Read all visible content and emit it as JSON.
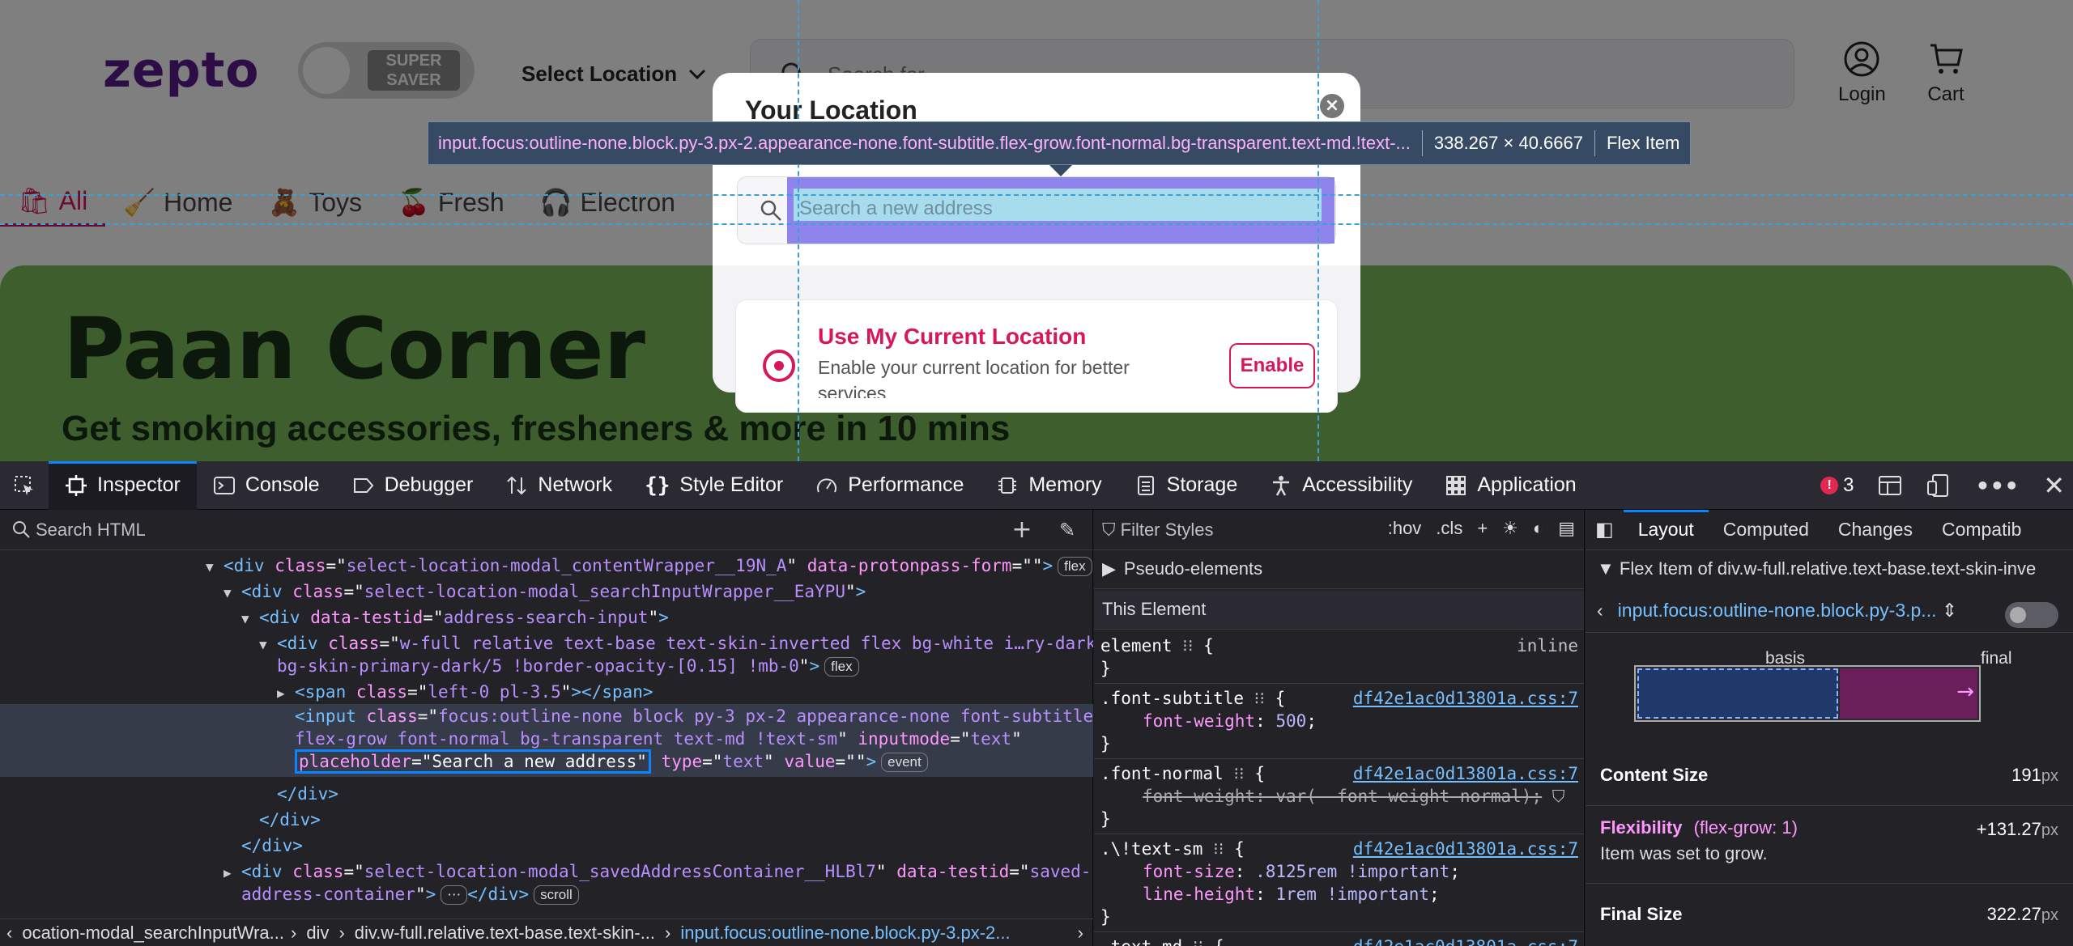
{
  "site": {
    "logo": "zepto",
    "super_saver": "SUPER SAVER",
    "select_location": "Select Location",
    "search_placeholder": "Search for",
    "login": "Login",
    "cart": "Cart",
    "categories": [
      "All",
      "Home",
      "Toys",
      "Fresh",
      "Electron"
    ],
    "banner_title": "Paan Corner",
    "banner_subtitle": "Get smoking accessories, fresheners & more in 10 mins",
    "accent_color": "#d6175c",
    "brand_color": "#5a1a8c"
  },
  "modal": {
    "title": "Your Location",
    "address_placeholder": "Search a new address",
    "current_location_title": "Use My Current Location",
    "current_location_desc": "Enable your current location for better services",
    "enable_label": "Enable"
  },
  "highlighter": {
    "selector": "input.focus:outline-none.block.py-3.px-2.appearance-none.font-subtitle.flex-grow.font-normal.bg-transparent.text-md.!text-...",
    "size": "338.267 × 40.6667",
    "kind": "Flex Item"
  },
  "devtools": {
    "tabs": [
      "Inspector",
      "Console",
      "Debugger",
      "Network",
      "Style Editor",
      "Performance",
      "Memory",
      "Storage",
      "Accessibility",
      "Application"
    ],
    "active_tab": "Inspector",
    "error_count": "3",
    "html_search_placeholder": "Search HTML",
    "tree": {
      "r1": {
        "tag": "div",
        "attr1": "class",
        "val1": "select-location-modal_contentWrapper__19N_A",
        "attr2": "data-protonpass-form",
        "val2": "",
        "badge": "flex"
      },
      "r2": {
        "tag": "div",
        "attr1": "class",
        "val1": "select-location-modal_searchInputWrapper__EaYPU"
      },
      "r3": {
        "tag": "div",
        "attr1": "data-testid",
        "val1": "address-search-input"
      },
      "r4a": "w-full relative text-base text-skin-inverted flex bg-white i…ry-dark !",
      "r4b": "bg-skin-primary-dark/5 !border-opacity-[0.15] !mb-0",
      "r4_badge": "flex",
      "r5": {
        "tag": "span",
        "attr1": "class",
        "val1": "left-0 pl-3.5"
      },
      "r6a": "focus:outline-none block py-3 px-2 appearance-none font-subtitle",
      "r6b": "flex-grow font-normal bg-transparent text-md !text-sm",
      "r6_inputmode": "text",
      "r6_placeholder": "Search a new address",
      "r6_type": "text",
      "r6_value": "",
      "r6_badge": "event",
      "r10a": "select-location-modal_savedAddressContainer__HLBl7",
      "r10_testid_a": "saved-",
      "r10_testid_b": "address-container",
      "r10_badge": "scroll"
    },
    "breadcrumbs": [
      "ocation-modal_searchInputWra...",
      "div",
      "div.w-full.relative.text-base.text-skin-...",
      "input.focus:outline-none.block.py-3.px-2..."
    ],
    "rules": {
      "filter_placeholder": "Filter Styles",
      "pseudo": "Pseudo-elements",
      "this_element": "This Element",
      "element_mode": "inline",
      "src": "df42e1ac0d13801a.css:7",
      "r1_sel": ".font-subtitle",
      "r1_prop": "font-weight",
      "r1_val": "500",
      "r2_sel": ".font-normal",
      "r2_decl": "font-weight: var(--font-weight-normal);",
      "r3_sel": ".\\!text-sm",
      "r3_p1": "font-size",
      "r3_v1": ".8125rem !important",
      "r3_p2": "line-height",
      "r3_v2": "1rem !important",
      "r4_sel": ".text-md"
    },
    "layout": {
      "tabs": [
        "Layout",
        "Computed",
        "Changes",
        "Compatib"
      ],
      "flex_item_of": "Flex Item of div.w-full.relative.text-base.text-skin-inve",
      "selected": "input.focus:outline-none.block.py-3.p...",
      "basis_label": "basis",
      "final_label": "final",
      "content_size_label": "Content Size",
      "content_size_value": "191",
      "flexibility_label": "Flexibility",
      "flexibility_grow": "(flex-grow: 1)",
      "flexibility_value": "+131.27",
      "flexibility_note": "Item was set to grow.",
      "final_size_label": "Final Size",
      "final_size_value": "322.27",
      "unit": "px"
    }
  }
}
